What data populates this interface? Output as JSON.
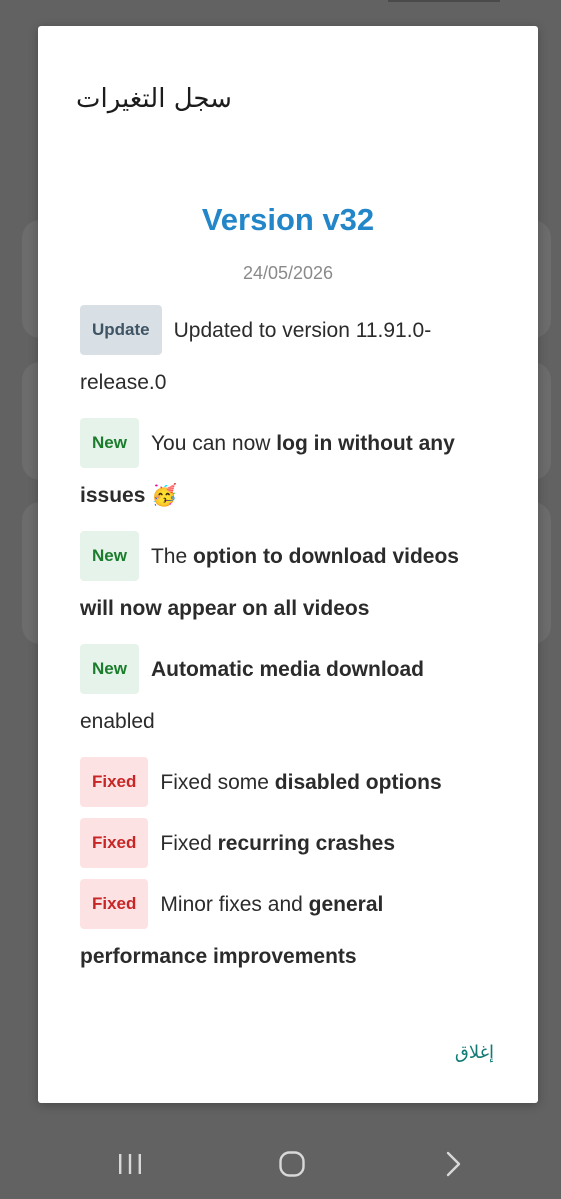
{
  "dialog": {
    "title": "سجل التغيرات",
    "version": "Version v32",
    "date": "24/05/2026",
    "close_label": "إغلاق"
  },
  "changes": [
    {
      "type": "Update",
      "parts": [
        {
          "text": "Updated to version 11.91.0-release.0",
          "bold": false
        }
      ]
    },
    {
      "type": "New",
      "parts": [
        {
          "text": "You can now ",
          "bold": false
        },
        {
          "text": "log in without any issues",
          "bold": true
        },
        {
          "text": " 🥳",
          "bold": false
        }
      ]
    },
    {
      "type": "New",
      "parts": [
        {
          "text": "The ",
          "bold": false
        },
        {
          "text": "option to download videos will now appear on all videos",
          "bold": true
        }
      ]
    },
    {
      "type": "New",
      "parts": [
        {
          "text": "Automatic media download",
          "bold": true
        },
        {
          "text": " enabled",
          "bold": false
        }
      ]
    },
    {
      "type": "Fixed",
      "parts": [
        {
          "text": "Fixed some ",
          "bold": false
        },
        {
          "text": "disabled options",
          "bold": true
        }
      ]
    },
    {
      "type": "Fixed",
      "parts": [
        {
          "text": "Fixed ",
          "bold": false
        },
        {
          "text": "recurring crashes",
          "bold": true
        }
      ]
    },
    {
      "type": "Fixed",
      "parts": [
        {
          "text": "Minor fixes and ",
          "bold": false
        },
        {
          "text": "general performance improvements",
          "bold": true
        }
      ]
    }
  ],
  "colors": {
    "version_title": "#2286c8",
    "update_badge_bg": "#d9e0e5",
    "new_badge_bg": "#e5f3ea",
    "new_badge_text": "#1b7d2c",
    "fixed_badge_bg": "#fde2e3",
    "fixed_badge_text": "#c82626",
    "close_button": "#127a74"
  },
  "navbar": {
    "recent_icon": "recent-apps-icon",
    "home_icon": "home-icon",
    "back_icon": "back-icon"
  }
}
